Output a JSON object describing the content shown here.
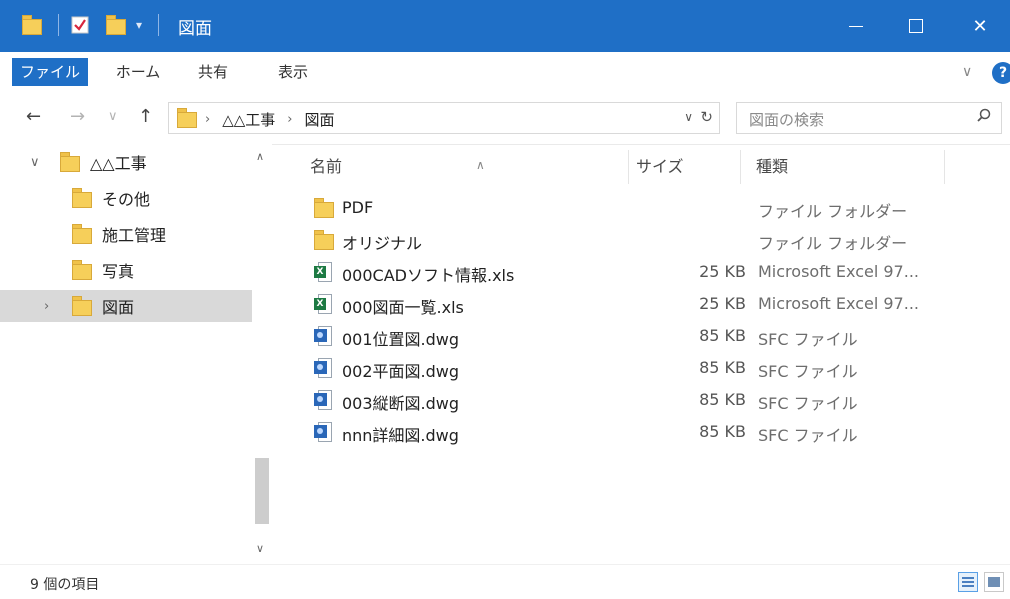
{
  "window": {
    "title": "図面",
    "controls": {
      "minimize": "—",
      "maximize": "□",
      "close": "✕"
    }
  },
  "ribbon": {
    "tabs": [
      "ファイル",
      "ホーム",
      "共有",
      "表示"
    ],
    "collapse_glyph": "∨",
    "help_glyph": "?"
  },
  "nav": {
    "back": "←",
    "forward": "→",
    "recent": "∨",
    "up": "↑",
    "breadcrumb": [
      "△△工事",
      "図面"
    ],
    "search_placeholder": "図面の検索"
  },
  "tree": [
    {
      "label": "△△工事",
      "level": 0,
      "expanded": true,
      "selected": false
    },
    {
      "label": "その他",
      "level": 1,
      "expanded": false,
      "selected": false
    },
    {
      "label": "施工管理",
      "level": 1,
      "expanded": false,
      "selected": false
    },
    {
      "label": "写真",
      "level": 1,
      "expanded": false,
      "selected": false
    },
    {
      "label": "図面",
      "level": 1,
      "expanded": false,
      "selected": true
    }
  ],
  "columns": {
    "name": "名前",
    "size": "サイズ",
    "type": "種類"
  },
  "files": [
    {
      "name": "PDF",
      "size": "",
      "type": "ファイル フォルダー",
      "icon": "folder-icon"
    },
    {
      "name": "オリジナル",
      "size": "",
      "type": "ファイル フォルダー",
      "icon": "folder-icon"
    },
    {
      "name": "000CADソフト情報.xls",
      "size": "25 KB",
      "type": "Microsoft Excel 97...",
      "icon": "excel-file-icon"
    },
    {
      "name": "000図面一覧.xls",
      "size": "25 KB",
      "type": "Microsoft Excel 97...",
      "icon": "excel-file-icon"
    },
    {
      "name": "001位置図.dwg",
      "size": "85 KB",
      "type": "SFC ファイル",
      "icon": "dwg-file-icon"
    },
    {
      "name": "002平面図.dwg",
      "size": "85 KB",
      "type": "SFC ファイル",
      "icon": "dwg-file-icon"
    },
    {
      "name": "003縦断図.dwg",
      "size": "85 KB",
      "type": "SFC ファイル",
      "icon": "dwg-file-icon"
    },
    {
      "name": "nnn詳細図.dwg",
      "size": "85 KB",
      "type": "SFC ファイル",
      "icon": "dwg-file-icon"
    }
  ],
  "status": {
    "item_count": "9 個の項目"
  },
  "colors": {
    "accent": "#1f6fc6",
    "folder": "#f6cf5a",
    "selected": "#d9d9d9"
  }
}
